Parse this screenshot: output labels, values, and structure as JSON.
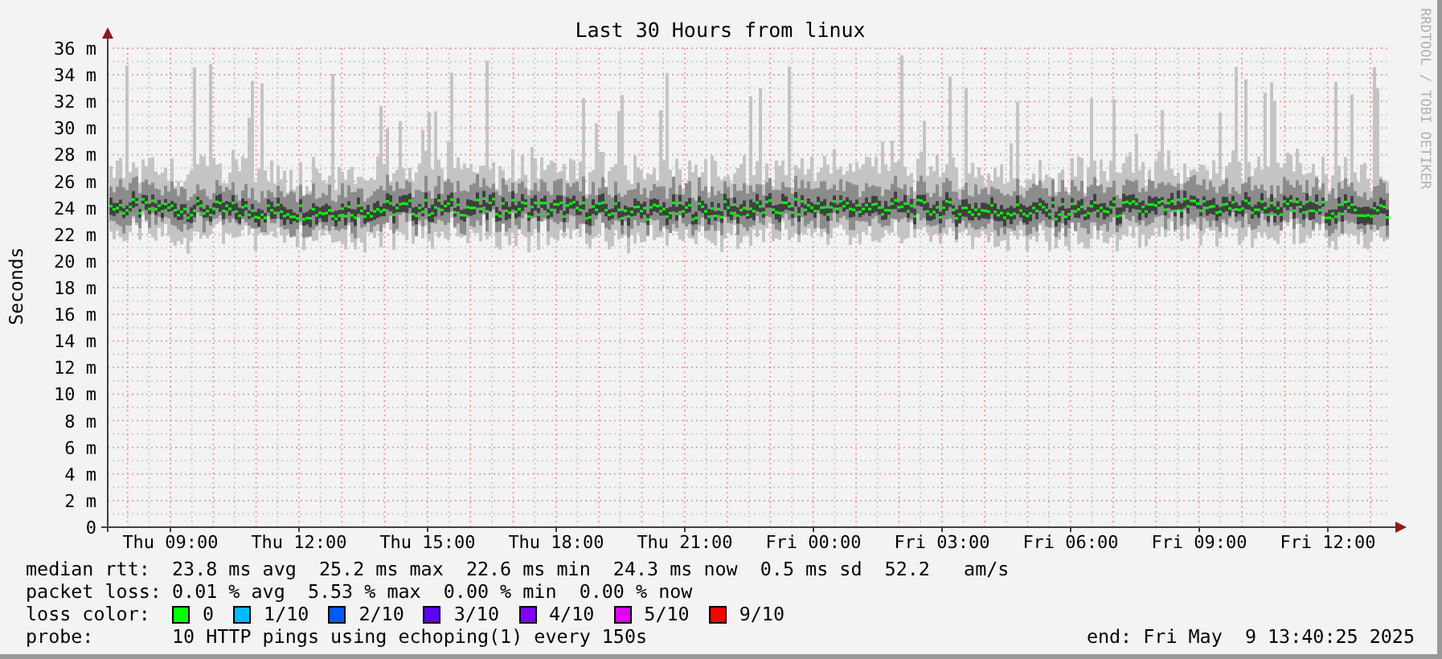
{
  "chart": {
    "credit": "RRDTOOL / TOBI OETIKER",
    "title": "Last 30 Hours from linux",
    "y_label": "Seconds",
    "x_ticks": [
      "Thu 09:00",
      "Thu 12:00",
      "Thu 15:00",
      "Thu 18:00",
      "Thu 21:00",
      "Fri 00:00",
      "Fri 03:00",
      "Fri 06:00",
      "Fri 09:00",
      "Fri 12:00"
    ],
    "y_ticks": [
      "36 m",
      "34 m",
      "32 m",
      "30 m",
      "28 m",
      "26 m",
      "24 m",
      "22 m",
      "20 m",
      "18 m",
      "16 m",
      "14 m",
      "12 m",
      "10 m",
      "8 m",
      "6 m",
      "4 m",
      "2 m",
      "0"
    ]
  },
  "legend": {
    "stats": [
      {
        "label": "median rtt:",
        "value": "23.8 ms avg  25.2 ms max  22.6 ms min  24.3 ms now  0.5 ms sd  52.2   am/s"
      },
      {
        "label": "packet loss:",
        "value": "0.01 % avg  5.53 % max  0.00 % min  0.00 % now"
      }
    ],
    "loss_color": {
      "label": "loss color:",
      "items": [
        {
          "label": "0",
          "color": "#00ff00"
        },
        {
          "label": "1/10",
          "color": "#00b8ff"
        },
        {
          "label": "2/10",
          "color": "#0059ff"
        },
        {
          "label": "3/10",
          "color": "#5e00ff"
        },
        {
          "label": "4/10",
          "color": "#7e00ff"
        },
        {
          "label": "5/10",
          "color": "#dd00ff"
        },
        {
          "label": "9/10",
          "color": "#ff0000"
        }
      ]
    },
    "probe": {
      "label": "probe:",
      "value": "10 HTTP pings using echoping(1) every 150s"
    },
    "end": "end: Fri May  9 13:40:25 2025"
  }
}
